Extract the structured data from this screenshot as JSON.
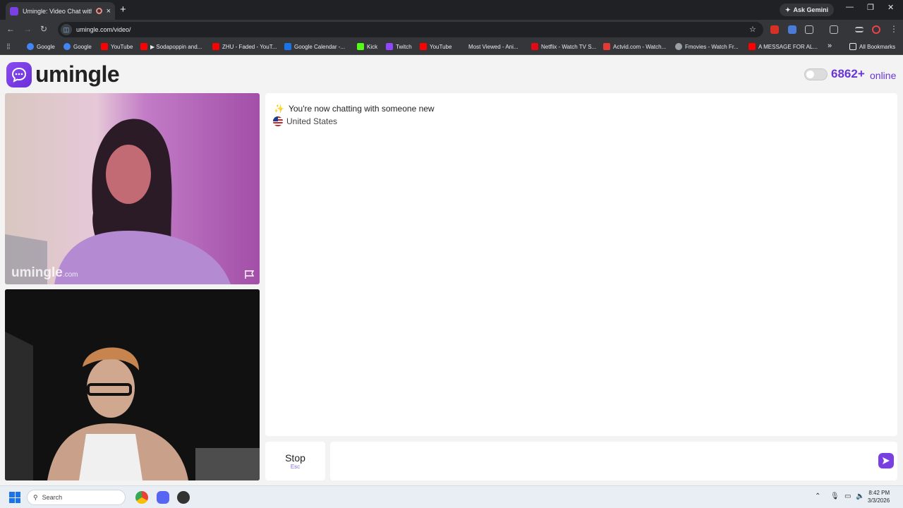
{
  "browser": {
    "tab_title": "Umingle: Video Chat with S",
    "tab_close": "×",
    "new_tab": "+",
    "ask_gemini": "Ask Gemini",
    "url": "umingle.com/video/",
    "bookmarks": [
      {
        "label": "Google",
        "color": "#4285f4"
      },
      {
        "label": "Google",
        "color": "#4285f4"
      },
      {
        "label": "YouTube",
        "color": "#ff0000"
      },
      {
        "label": "▶ Sodapoppin and...",
        "color": "#ff0000"
      },
      {
        "label": "ZHU - Faded - YouT...",
        "color": "#ff0000"
      },
      {
        "label": "Google Calendar -...",
        "color": "#1a73e8"
      },
      {
        "label": "Kick",
        "color": "#53fc18"
      },
      {
        "label": "Twitch",
        "color": "#9146ff"
      },
      {
        "label": "YouTube",
        "color": "#ff0000"
      },
      {
        "label": "Most Viewed - Ani...",
        "color": "#35363a"
      },
      {
        "label": "Netflix - Watch TV S...",
        "color": "#e50914"
      },
      {
        "label": "Actvid.com - Watch...",
        "color": "#e53935"
      },
      {
        "label": "Fmovies - Watch Fr...",
        "color": "#9aa0a6"
      },
      {
        "label": "A MESSAGE FOR AL...",
        "color": "#ff0000"
      }
    ],
    "more_bookmarks": "»",
    "all_bookmarks": "All Bookmarks"
  },
  "app": {
    "logo_text": "umingle",
    "online_count": "6862+",
    "online_label": "online",
    "brand_color": "#6b35d6"
  },
  "videos": {
    "watermark_main": "umingle",
    "watermark_suffix": ".com"
  },
  "chat": {
    "sparkle": "✨",
    "status_message": "You're now chatting with someone new",
    "country": "United States"
  },
  "controls": {
    "stop_label": "Stop",
    "stop_hint": "Esc",
    "message_placeholder": ""
  },
  "taskbar": {
    "search_placeholder": "Search",
    "time": "8:42 PM",
    "date": "3/3/2026"
  }
}
